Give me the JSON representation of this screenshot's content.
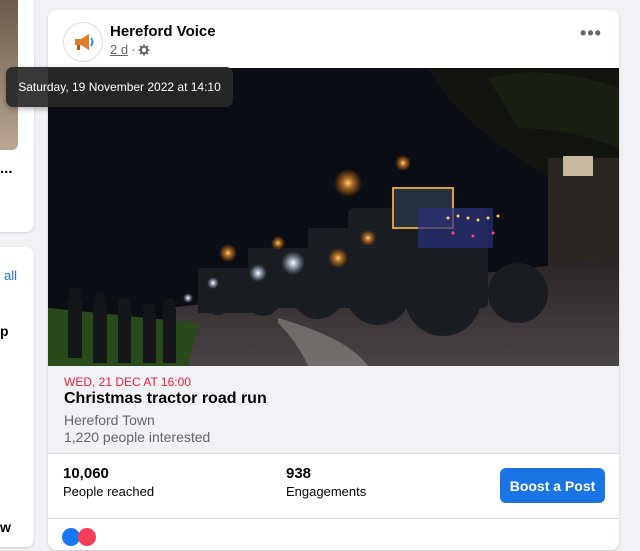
{
  "left_column": {
    "ellipsis": "...",
    "see_all_fragment": "all",
    "fragment_1": "p",
    "fragment_2": "w"
  },
  "post": {
    "page_name": "Hereford Voice",
    "time_ago": "2 d",
    "separator": "·",
    "audience_icon": "gear-icon",
    "more_icon": "more-options-icon",
    "tooltip": "Saturday, 19 November 2022 at 14:10"
  },
  "event": {
    "date": "WED, 21 DEC AT 16:00",
    "title": "Christmas tractor road run",
    "location": "Hereford Town",
    "interested": "1,220 people interested"
  },
  "insights": {
    "reach_value": "10,060",
    "reach_label": "People reached",
    "engagement_value": "938",
    "engagement_label": "Engagements",
    "boost_label": "Boost a Post"
  },
  "colors": {
    "accent": "#1b74e4",
    "event_date": "#e41e3f",
    "background": "#f0f2f5"
  }
}
